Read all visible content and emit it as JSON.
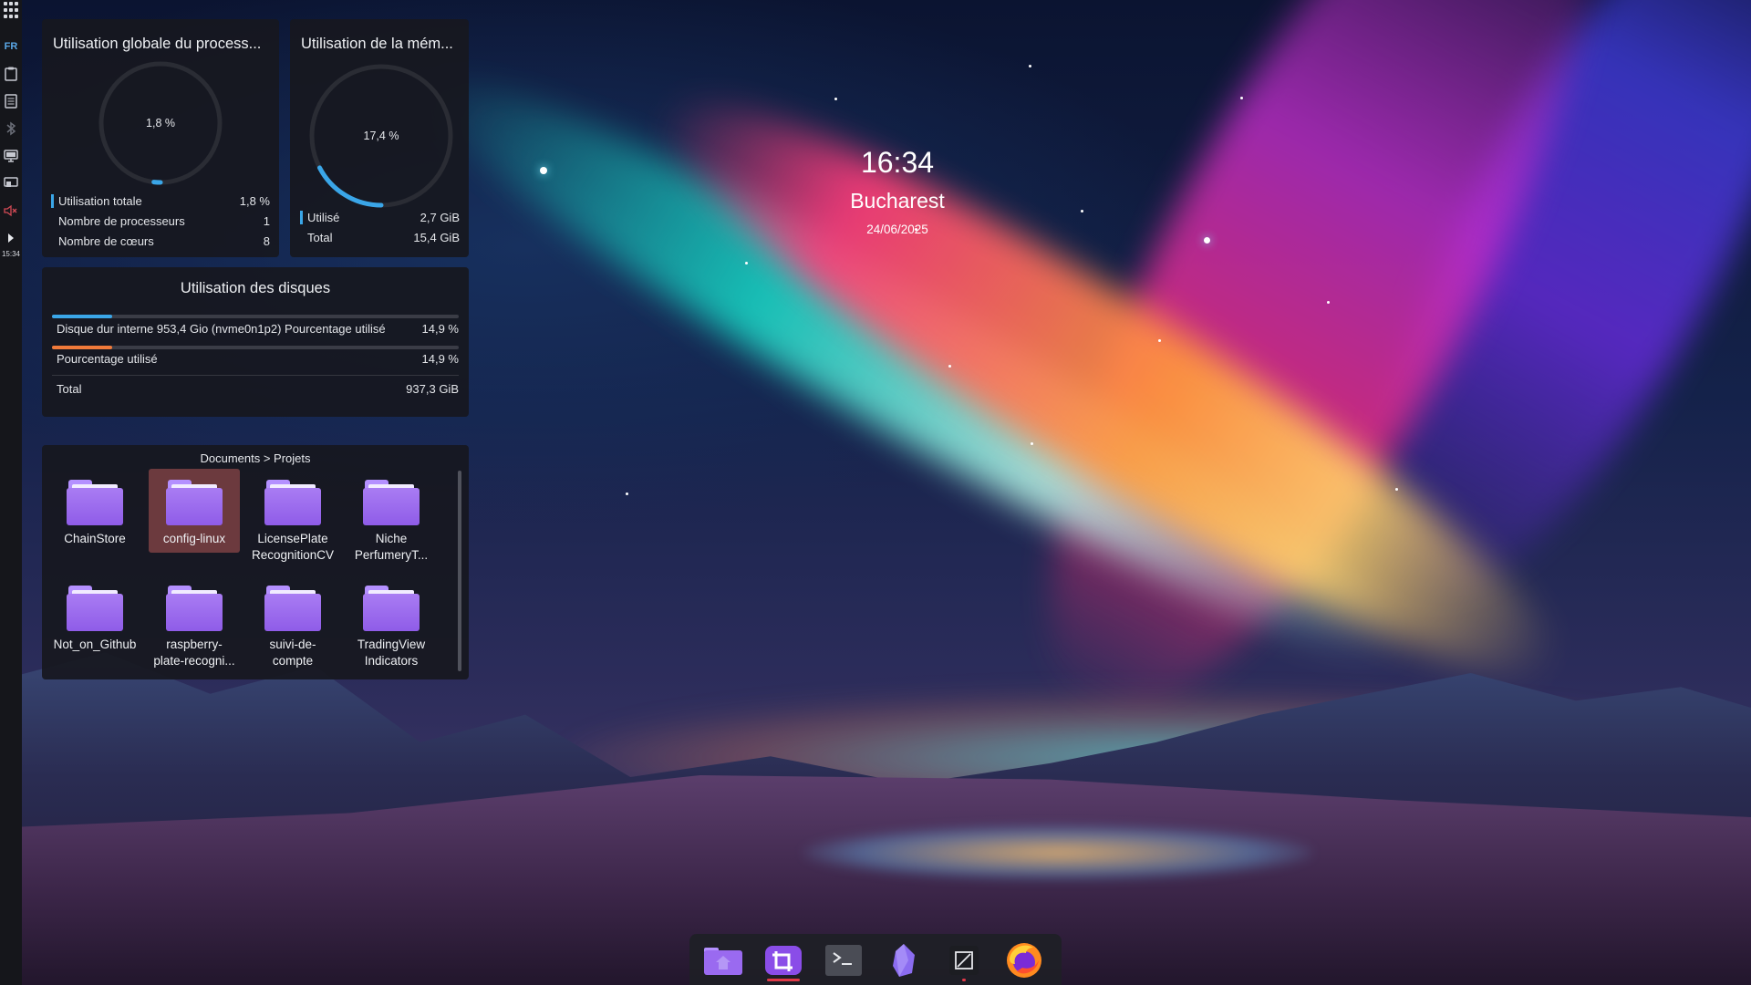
{
  "desktop": {
    "panel": {
      "language": "FR",
      "clock": "15:34"
    },
    "cpu_widget": {
      "title": "Utilisation globale du process...",
      "gauge_label": "1,8 %",
      "usage_fraction": 0.018,
      "rows": [
        {
          "label": "Utilisation totale",
          "value": "1,8 %"
        },
        {
          "label": "Nombre de processeurs",
          "value": "1"
        },
        {
          "label": "Nombre de cœurs",
          "value": "8"
        }
      ]
    },
    "memory_widget": {
      "title": "Utilisation de la mém...",
      "gauge_label": "17,4 %",
      "usage_fraction": 0.174,
      "rows": [
        {
          "label": "Utilisé",
          "value": "2,7 GiB"
        },
        {
          "label": "Total",
          "value": "15,4 GiB"
        }
      ]
    },
    "disk_widget": {
      "title": "Utilisation des disques",
      "used_fraction": 0.149,
      "rows": [
        {
          "label": "Disque dur interne 953,4 Gio (nvme0n1p2) Pourcentage utilisé",
          "value": "14,9 %"
        },
        {
          "label": "Pourcentage utilisé",
          "value": "14,9 %"
        },
        {
          "label": "Total",
          "value": "937,3 GiB"
        }
      ]
    },
    "folder_widget": {
      "path": "Documents > Projets",
      "folders": [
        {
          "line1": "ChainStore",
          "line2": ""
        },
        {
          "line1": "config-linux",
          "line2": ""
        },
        {
          "line1": "LicensePlate",
          "line2": "RecognitionCV"
        },
        {
          "line1": "Niche",
          "line2": "PerfumeryT..."
        },
        {
          "line1": "Not_on_Github",
          "line2": ""
        },
        {
          "line1": "raspberry-",
          "line2": "plate-recogni..."
        },
        {
          "line1": "suivi-de-",
          "line2": "compte"
        },
        {
          "line1": "TradingView",
          "line2": "Indicators"
        }
      ],
      "selected": "config-linux"
    },
    "clock": {
      "time": "16:34",
      "city": "Bucharest",
      "date": "24/06/2025"
    },
    "dock": {
      "apps": [
        "file-manager",
        "screenshot-tool",
        "terminal",
        "obsidian",
        "text-editor",
        "firefox"
      ],
      "active": "screenshot-tool"
    },
    "colors": {
      "accent_blue": "#3aa6e8",
      "disk_orange": "#f07a3a",
      "folder_purple": "#9a6af0",
      "selected_bg": "#6c3a3e",
      "indicator_red": "#e03a48"
    }
  }
}
